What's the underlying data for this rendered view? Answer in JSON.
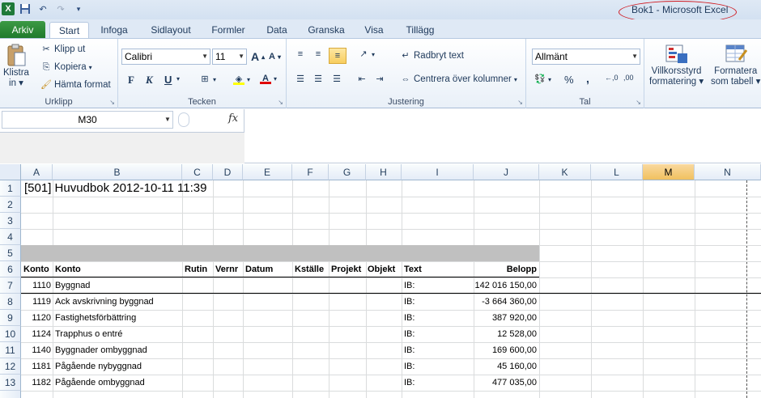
{
  "window": {
    "title": "Bok1  -  Microsoft Excel"
  },
  "qat": {
    "icons": [
      "excel-logo",
      "save-icon",
      "undo-icon",
      "redo-icon",
      "customize-icon"
    ]
  },
  "tabs": [
    "Arkiv",
    "Start",
    "Infoga",
    "Sidlayout",
    "Formler",
    "Data",
    "Granska",
    "Visa",
    "Tillägg"
  ],
  "ribbon": {
    "clipboard": {
      "label": "Urklipp",
      "paste": "Klistra\nin",
      "paste_line1": "Klistra",
      "paste_line2": "in",
      "cut": "Klipp ut",
      "copy": "Kopiera",
      "format_painter": "Hämta format"
    },
    "font": {
      "label": "Tecken",
      "name": "Calibri",
      "size": "11",
      "bold": "F",
      "italic": "K",
      "underline": "U"
    },
    "alignment": {
      "label": "Justering",
      "wrap": "Radbryt text",
      "merge": "Centrera över kolumner"
    },
    "number": {
      "label": "Tal",
      "format": "Allmänt",
      "percent": "%",
      "comma": ","
    },
    "styles": {
      "conditional_line1": "Villkorsstyrd",
      "conditional_line2": "formatering",
      "table_line1": "Formatera",
      "table_line2": "som tabell"
    }
  },
  "formula_bar": {
    "name_box": "M30",
    "fx": "fx",
    "value": ""
  },
  "columns": [
    "A",
    "B",
    "C",
    "D",
    "E",
    "F",
    "G",
    "H",
    "I",
    "J",
    "K",
    "L",
    "M",
    "N"
  ],
  "selected_column": "M",
  "rows": [
    "1",
    "2",
    "3",
    "4",
    "5",
    "6",
    "7",
    "8",
    "9",
    "10",
    "11",
    "12",
    "13"
  ],
  "sheet": {
    "title": "[501]  Huvudbok 2012-10-11 11:39",
    "headers": [
      "Konto",
      "Konto",
      "Rutin",
      "Vernr",
      "Datum",
      "Kställe",
      "Projekt",
      "Objekt",
      "Text",
      "Belopp"
    ],
    "data": [
      {
        "konto": "1110",
        "namn": "Byggnad",
        "text": "IB:",
        "belopp": "142 016 150,00"
      },
      {
        "konto": "1119",
        "namn": "Ack avskrivning byggnad",
        "text": "IB:",
        "belopp": "-3 664 360,00"
      },
      {
        "konto": "1120",
        "namn": "Fastighetsförbättring",
        "text": "IB:",
        "belopp": "387 920,00"
      },
      {
        "konto": "1124",
        "namn": "Trapphus o entré",
        "text": "IB:",
        "belopp": "12 528,00"
      },
      {
        "konto": "1140",
        "namn": "Byggnader ombyggnad",
        "text": "IB:",
        "belopp": "169 600,00"
      },
      {
        "konto": "1181",
        "namn": "Pågående nybyggnad",
        "text": "IB:",
        "belopp": "45 160,00"
      },
      {
        "konto": "1182",
        "namn": "Pågående ombyggnad",
        "text": "IB:",
        "belopp": "477 035,00"
      }
    ]
  },
  "colors": {
    "file_tab": "#1f7a2c",
    "selected_header": "#f1c15f",
    "band": "#c0c0c0",
    "title_oval": "#d0181f"
  }
}
